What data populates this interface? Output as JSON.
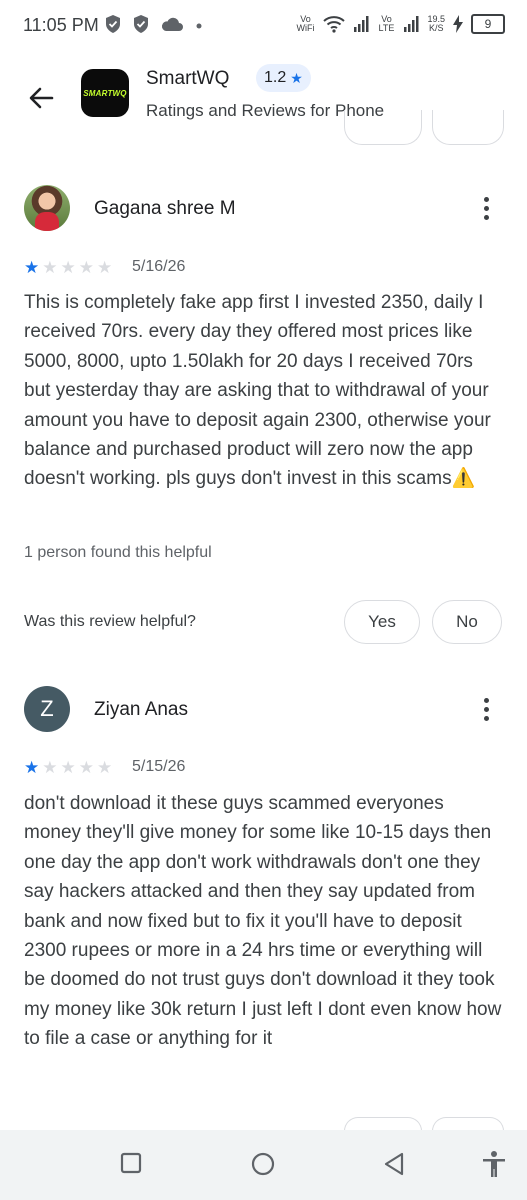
{
  "status_bar": {
    "time": "11:05 PM",
    "vo_wifi": "Vo WiFi",
    "vo_lte": "Vo LTE",
    "speed_value": "19.5",
    "speed_unit": "K/S",
    "battery": "9"
  },
  "header": {
    "logo_text": "SMARTWQ",
    "app_name": "SmartWQ",
    "rating": "1.2",
    "subtitle": "Ratings and Reviews for Phone"
  },
  "reviews": [
    {
      "author": "Gagana shree M",
      "avatar_letter": "",
      "stars": 1,
      "date": "5/16/26",
      "text": "This is completely fake app first I invested 2350, daily I received 70rs. every day they offered most prices like 5000, 8000, upto 1.50lakh for 20 days I received 70rs but yesterday thay are asking that to withdrawal of your amount you have to deposit again 2300, otherwise your balance and purchased product will zero now the app doesn't working. pls guys don't invest in this scams⚠️",
      "helpful_count": "1 person found this helpful",
      "helpful_question": "Was this review helpful?",
      "yes_label": "Yes",
      "no_label": "No"
    },
    {
      "author": "Ziyan Anas",
      "avatar_letter": "Z",
      "stars": 1,
      "date": "5/15/26",
      "text": "don't download it these guys scammed everyones money they'll give money for some like 10-15 days then one day the app don't work withdrawals don't one they say hackers attacked and then they say updated from bank and now fixed but to fix it you'll have to deposit 2300 rupees or more in a 24 hrs time or everything will be doomed do not trust guys don't download it they took my money like 30k return I just left I dont even know how to file a case or anything for it"
    }
  ],
  "colors": {
    "accent": "#1a73e8",
    "star_off": "#dadce0",
    "avatar_letter_bg": "#455a64"
  }
}
